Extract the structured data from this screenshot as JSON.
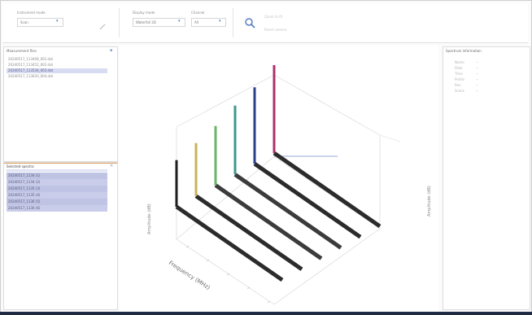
{
  "toolbar": {
    "group1_label": "Instrument mode",
    "group1_value": "Scan",
    "group2_label": "Display mode",
    "group2_value": "Waterfall 3D",
    "group3_label": "Channel",
    "group3_value": "All",
    "zoom_icon": "magnifier-zoom-icon",
    "settings_line1": "Zoom to fit",
    "settings_line2": "Reset camera"
  },
  "left_top": {
    "title": "Measurement files",
    "items": [
      {
        "label": "20240517_113408_001.dat"
      },
      {
        "label": "20240517_113452_002.dat"
      },
      {
        "label": "20240517_113536_003.dat"
      },
      {
        "label": "20240517_113620_004.dat"
      }
    ],
    "selected_index": 2
  },
  "left_bottom": {
    "title": "Selected spectra",
    "rows": [
      {
        "label": "20240517_1134 (1)"
      },
      {
        "label": "20240517_1134 (2)"
      },
      {
        "label": "20240517_1135 (3)"
      },
      {
        "label": "20240517_1135 (4)"
      },
      {
        "label": "20240517_1136 (5)"
      },
      {
        "label": "20240517_1136 (6)"
      }
    ]
  },
  "right_panel": {
    "title": "Spectrum information",
    "rows": [
      {
        "k": "Name",
        "v": "--"
      },
      {
        "k": "Date",
        "v": "--"
      },
      {
        "k": "Time",
        "v": "--"
      },
      {
        "k": "Points",
        "v": "--"
      },
      {
        "k": "Res.",
        "v": "--"
      },
      {
        "k": "Scans",
        "v": "--"
      }
    ]
  },
  "chart_data": {
    "type": "line",
    "title": "",
    "xlabel": "Frequency (MHz)",
    "ylabel": "Amplitude (dB)",
    "zlabel": "Amplitude (dB)",
    "series": [
      {
        "values": [
          1,
          1,
          1,
          1,
          1,
          1,
          1,
          1
        ],
        "color": "#2b2b2b",
        "peak": 0.35
      },
      {
        "values": [
          1,
          1,
          1,
          1,
          1,
          1,
          1,
          1
        ],
        "color": "#2b2b2b",
        "peak": 0.45
      },
      {
        "values": [
          1,
          1,
          1,
          1,
          1,
          1,
          1,
          1
        ],
        "color": "#3b3b3b",
        "peak": 0.55
      },
      {
        "values": [
          1,
          1,
          1,
          1,
          1,
          1,
          1,
          1
        ],
        "color": "#3b3b3b",
        "peak": 0.7
      },
      {
        "values": [
          1,
          1,
          1,
          1,
          1,
          1,
          1,
          1
        ],
        "color": "#2b2b2b",
        "peak": 0.82
      },
      {
        "values": [
          1,
          1,
          1,
          1,
          1,
          1,
          1,
          1
        ],
        "color": "#2b2b2b",
        "peak": 1.0
      }
    ],
    "peak_colors": [
      "#1e1e1e",
      "#c8b35a",
      "#6ab56a",
      "#3c9a8a",
      "#2a3f8c",
      "#b0306a"
    ],
    "x_ticks": [
      "",
      "",
      "",
      "",
      "",
      ""
    ],
    "grid": true
  }
}
